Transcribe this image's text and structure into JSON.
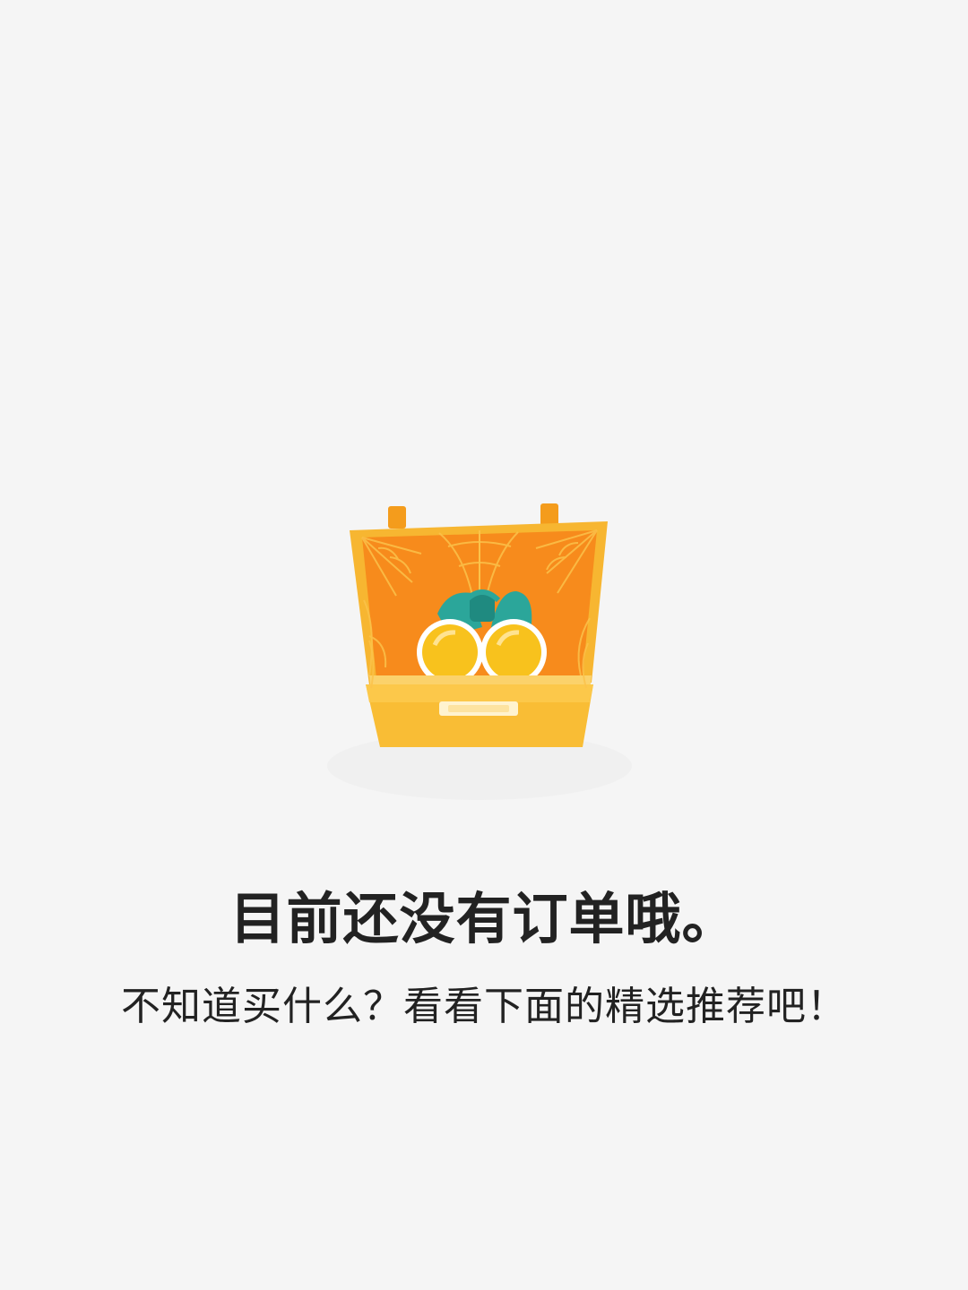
{
  "empty_state": {
    "illustration_icon": "open-suitcase-binoculars-icon",
    "title": "目前还没有订单哦。",
    "subtitle": "不知道买什么？看看下面的精选推荐吧！"
  },
  "colors": {
    "background": "#f5f5f5",
    "text": "#222222",
    "suitcase_body": "#f9bd35",
    "suitcase_inner": "#f78b1c",
    "binoculars": "#2ba69a",
    "lens": "#f8c21d"
  }
}
